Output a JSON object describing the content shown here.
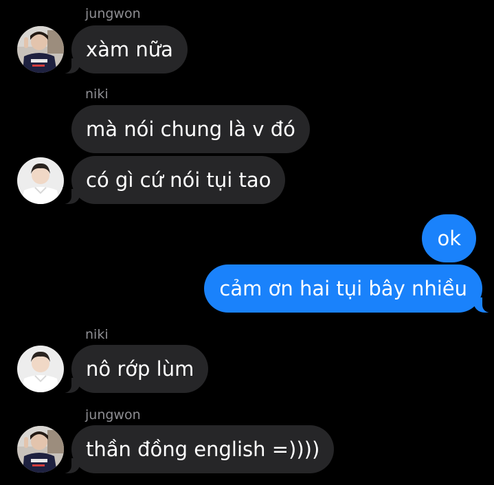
{
  "colors": {
    "background": "#000000",
    "incoming_bubble": "#262628",
    "outgoing_bubble": "#1a82fb",
    "sender_name": "#8e8e93",
    "text": "#ffffff"
  },
  "messages": [
    {
      "sender": "jungwon",
      "text": "xàm nữa",
      "direction": "incoming",
      "avatar": "jungwon-avatar-icon"
    },
    {
      "sender": "niki",
      "text": "mà nói chung là v đó",
      "direction": "incoming"
    },
    {
      "text": "có gì cứ nói tụi tao",
      "direction": "incoming",
      "avatar": "niki-avatar-icon"
    },
    {
      "text": "ok",
      "direction": "outgoing"
    },
    {
      "text": "cảm ơn hai tụi bây nhiều",
      "direction": "outgoing"
    },
    {
      "sender": "niki",
      "text": "nô rớp lùm",
      "direction": "incoming",
      "avatar": "niki-avatar-icon"
    },
    {
      "sender": "jungwon",
      "text": "thần đồng english =))))",
      "direction": "incoming",
      "avatar": "jungwon-avatar-icon"
    }
  ]
}
